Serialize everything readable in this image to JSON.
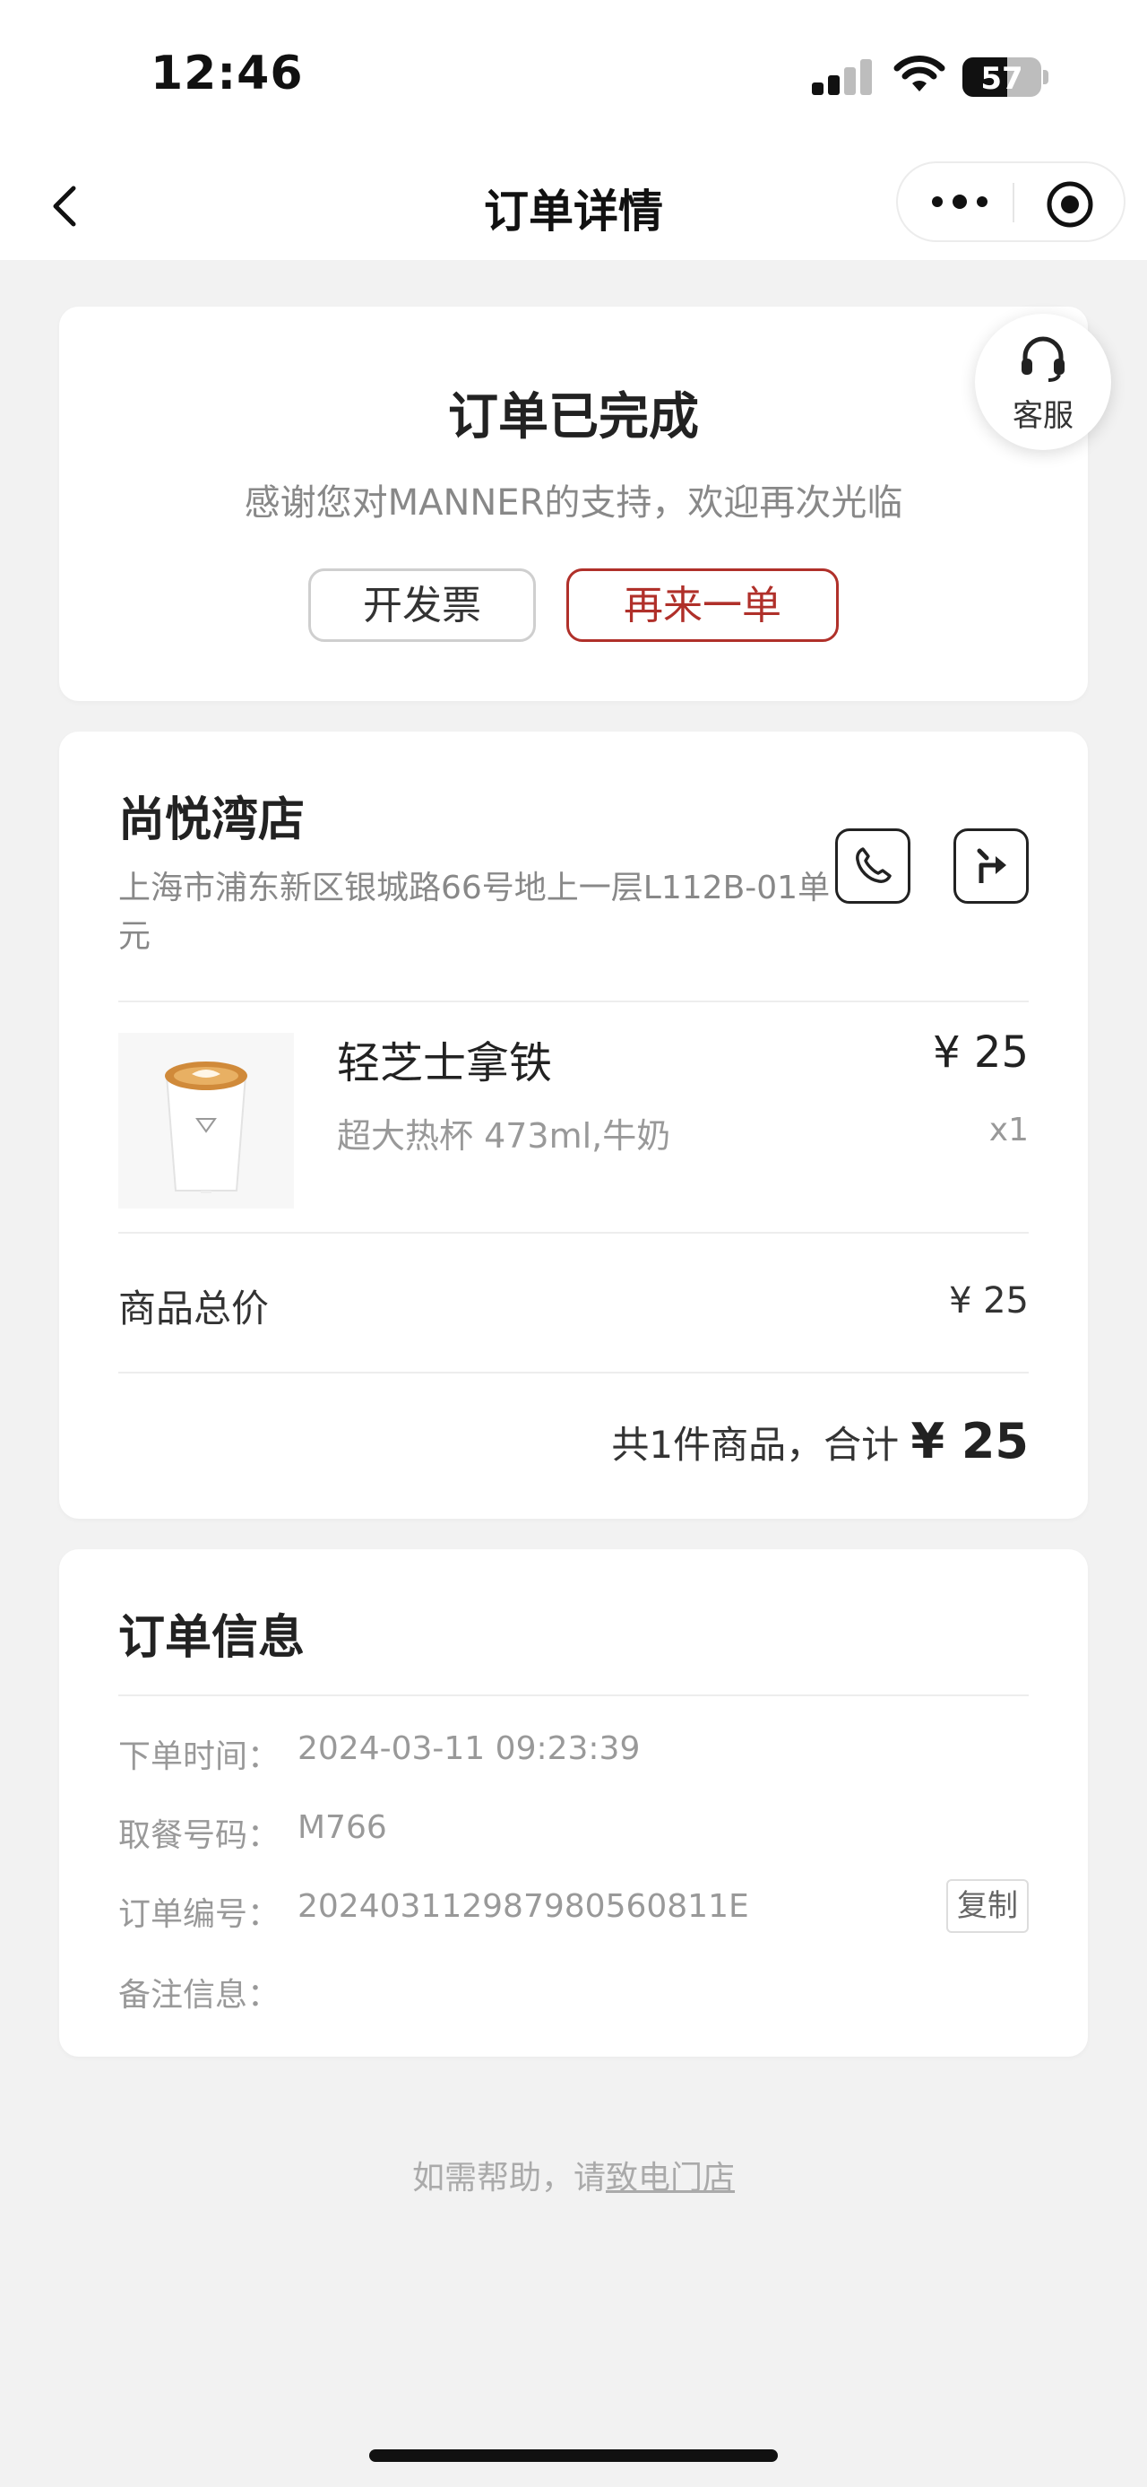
{
  "status_bar": {
    "time": "12:46",
    "battery": "57",
    "battery_level": 0.57
  },
  "nav": {
    "title": "订单详情"
  },
  "order_status": {
    "title": "订单已完成",
    "subtitle": "感谢您对MANNER的支持，欢迎再次光临",
    "invoice_button": "开发票",
    "reorder_button": "再来一单",
    "accent_color": "#b0302a"
  },
  "service": {
    "label": "客服"
  },
  "store": {
    "name": "尚悦湾店",
    "address": "上海市浦东新区银城路66号地上一层L112B-01单元"
  },
  "product": {
    "name": "轻芝士拿铁",
    "spec": "超大热杯 473ml,牛奶",
    "price": "¥ 25",
    "qty": "x1"
  },
  "summary": {
    "subtotal_label": "商品总价",
    "subtotal_value": "¥ 25",
    "total_prefix": "共1件商品，合计",
    "total_value": "¥ 25"
  },
  "order_info": {
    "title": "订单信息",
    "rows": [
      {
        "label": "下单时间：",
        "value": "2024-03-11 09:23:39"
      },
      {
        "label": "取餐号码：",
        "value": "M766"
      },
      {
        "label": "订单编号：",
        "value": "20240311298798056081​1E"
      },
      {
        "label": "备注信息：",
        "value": ""
      }
    ],
    "copy_button": "复制"
  },
  "help": {
    "prefix": "如需帮助，请",
    "link": "致电门店"
  }
}
